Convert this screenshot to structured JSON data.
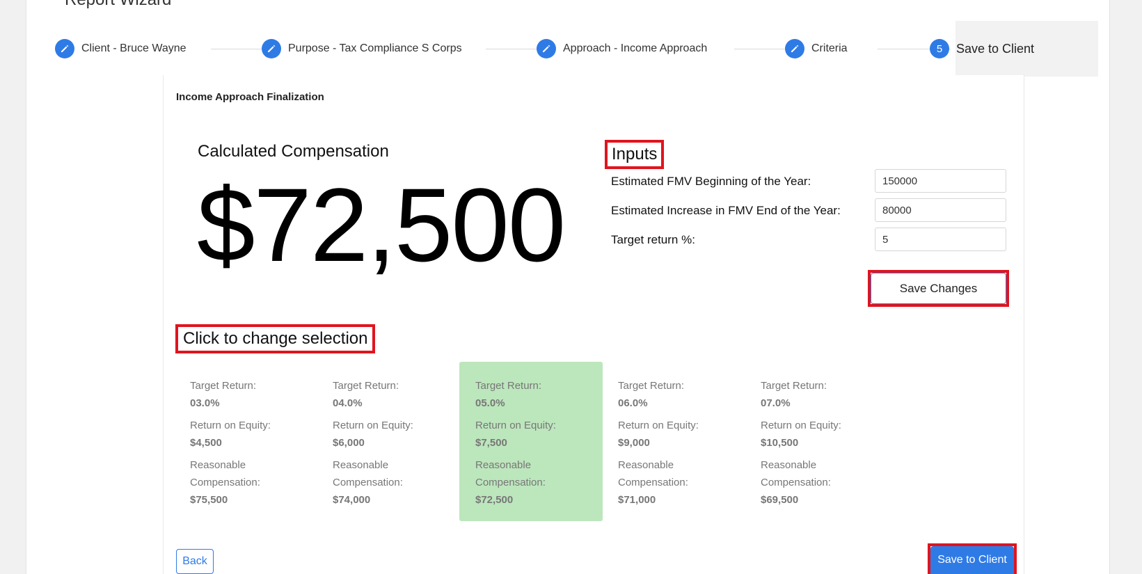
{
  "header": {
    "title": "Report Wizard"
  },
  "stepper": {
    "steps": [
      {
        "label": "Client - Bruce Wayne",
        "icon": "pencil-icon"
      },
      {
        "label": "Purpose - Tax Compliance S Corps",
        "icon": "pencil-icon"
      },
      {
        "label": "Approach - Income Approach",
        "icon": "pencil-icon"
      },
      {
        "label": "Criteria",
        "icon": "pencil-icon"
      },
      {
        "label": "Save to Client",
        "number": "5"
      }
    ],
    "active_color": "#2f7be6"
  },
  "main": {
    "section_title": "Income Approach Finalization",
    "calculated_label": "Calculated Compensation",
    "calculated_value": "$72,500"
  },
  "inputs": {
    "heading": "Inputs",
    "fields": [
      {
        "label": "Estimated FMV Beginning of the Year:",
        "value": "150000"
      },
      {
        "label": "Estimated Increase in FMV End of the Year:",
        "value": "80000"
      },
      {
        "label": "Target return %:",
        "value": "5"
      }
    ],
    "save_label": "Save Changes"
  },
  "selection": {
    "heading": "Click to change selection",
    "labels": {
      "target": "Target Return:",
      "roe": "Return on Equity:",
      "rc_line1": "Reasonable",
      "rc_line2": "Compensation:"
    },
    "options": [
      {
        "target": "03.0%",
        "roe": "$4,500",
        "comp": "$75,500",
        "selected": false
      },
      {
        "target": "04.0%",
        "roe": "$6,000",
        "comp": "$74,000",
        "selected": false
      },
      {
        "target": "05.0%",
        "roe": "$7,500",
        "comp": "$72,500",
        "selected": true
      },
      {
        "target": "06.0%",
        "roe": "$9,000",
        "comp": "$71,000",
        "selected": false
      },
      {
        "target": "07.0%",
        "roe": "$10,500",
        "comp": "$69,500",
        "selected": false
      }
    ],
    "selected_color": "#bce6bc"
  },
  "footer": {
    "back_label": "Back",
    "save_label": "Save to Client"
  },
  "colors": {
    "primary": "#2f7be6",
    "highlight": "#e0141e"
  }
}
